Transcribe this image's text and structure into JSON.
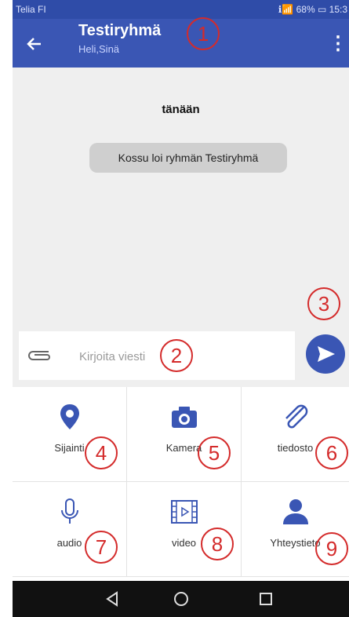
{
  "statusbar": {
    "carrier": "Telia FI",
    "right": "ℹ📶 68% ▭ 15:3"
  },
  "header": {
    "title": "Testiryhmä",
    "subtitle": "Heli,Sinä"
  },
  "chat": {
    "day_label": "tänään",
    "system_message": "Kossu loi ryhmän Testiryhmä"
  },
  "composer": {
    "placeholder": "Kirjoita viesti"
  },
  "attachments": [
    {
      "label": "Sijainti",
      "icon": "location-pin-icon"
    },
    {
      "label": "Kamera",
      "icon": "camera-icon"
    },
    {
      "label": "tiedosto",
      "icon": "paperclip-icon"
    },
    {
      "label": "audio",
      "icon": "microphone-icon"
    },
    {
      "label": "video",
      "icon": "video-film-icon"
    },
    {
      "label": "Yhteystieto",
      "icon": "person-icon"
    }
  ],
  "callouts": [
    "1",
    "2",
    "3",
    "4",
    "5",
    "6",
    "7",
    "8",
    "9"
  ],
  "colors": {
    "appbar": "#3a56b4",
    "accent": "#3a56b4",
    "callout": "#d42b2b"
  }
}
